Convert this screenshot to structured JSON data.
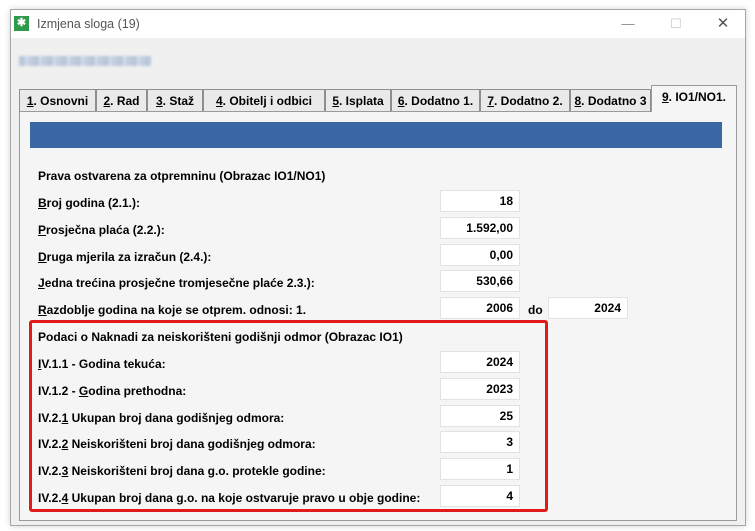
{
  "window": {
    "title": "Izmjena sloga (19)"
  },
  "tabs": [
    {
      "num": "1",
      "label": ". Osnovni"
    },
    {
      "num": "2",
      "label": ". Rad"
    },
    {
      "num": "3",
      "label": ". Staž"
    },
    {
      "num": "4",
      "label": ". Obitelj i odbici"
    },
    {
      "num": "5",
      "label": ". Isplata"
    },
    {
      "num": "6",
      "label": ". Dodatno 1."
    },
    {
      "num": "7",
      "label": ". Dodatno 2."
    },
    {
      "num": "8",
      "label": ". Dodatno 3"
    },
    {
      "num": "9",
      "label": ". IO1/NO1."
    }
  ],
  "section1": {
    "title": "Prava ostvarena za otpremninu (Obrazac IO1/NO1)",
    "rows": [
      {
        "key": "B",
        "rest": "roj godina (2.1.):",
        "value": "18"
      },
      {
        "key": "P",
        "rest": "rosječna plaća (2.2.):",
        "value": "1.592,00"
      },
      {
        "key": "D",
        "rest": "ruga mjerila za izračun (2.4.):",
        "value": "0,00"
      },
      {
        "key": "J",
        "rest": "edna trećina prosječne tromjesečne plaće 2.3.):",
        "value": "530,66"
      },
      {
        "key": "R",
        "rest": "azdoblje godina na koje se otprem. odnosi: 1.",
        "value": "2006"
      }
    ],
    "do_label": "do",
    "do_value": "2024"
  },
  "section2": {
    "title": "Podaci o Naknadi za neiskorišteni godišnji odmor (Obrazac IO1)",
    "rows": [
      {
        "pre": "I",
        "key": "V.1.1 - Godina tekuća:",
        "value": "2024"
      },
      {
        "pre": "IV.1.2 - ",
        "key": "G",
        "rest": "odina prethodna:",
        "value": "2023"
      },
      {
        "pre": "IV.2.",
        "key": "1",
        "rest": " Ukupan broj dana godišnjeg odmora:",
        "value": "25"
      },
      {
        "pre": "IV.2.",
        "key": "2",
        "rest": " Neiskorišteni broj dana godišnjeg odmora:",
        "value": "3"
      },
      {
        "pre": "IV.2.",
        "key": "3",
        "rest": " Neiskorišteni broj dana g.o. protekle godine:",
        "value": "1"
      },
      {
        "pre": "IV.2.",
        "key": "4",
        "rest": " Ukupan broj dana g.o. na koje ostvaruje pravo u obje godine:",
        "value": "4"
      }
    ]
  },
  "colors": {
    "accent_bar": "#3a68a4",
    "highlight_border": "#e11a1a",
    "app_icon": "#2e9a4b"
  }
}
